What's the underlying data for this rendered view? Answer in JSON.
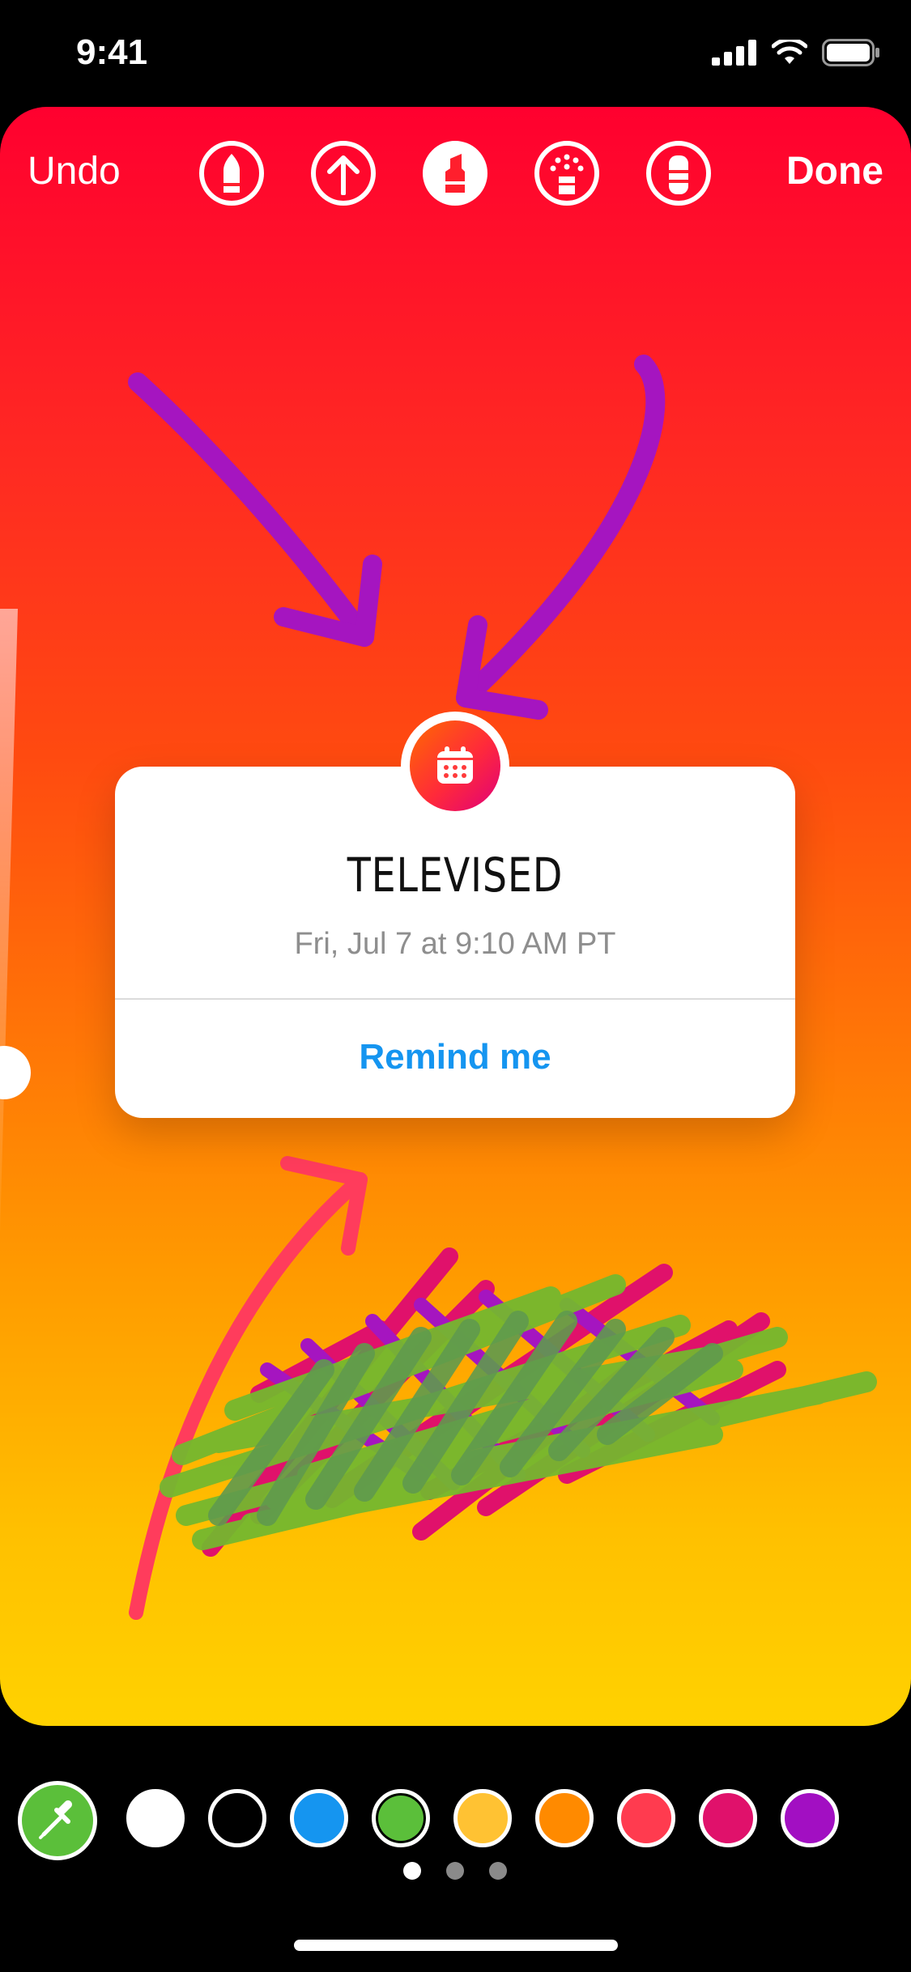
{
  "status_bar": {
    "time": "9:41"
  },
  "toolbar": {
    "undo_label": "Undo",
    "done_label": "Done",
    "tools": [
      "pen-icon",
      "arrow-icon",
      "marker-icon",
      "neon-icon",
      "eraser-icon"
    ],
    "active_tool": "marker-icon"
  },
  "sticker": {
    "title": "TELEVISED",
    "date": "Fri, Jul 7 at 9:10 AM PT",
    "action_label": "Remind me"
  },
  "palette": {
    "colors": [
      "#ffffff",
      "#000000",
      "#1595f0",
      "#5bbf3a",
      "#ffc233",
      "#ff8a00",
      "#ff3b4f",
      "#e0116b",
      "#a20fc2"
    ],
    "selected_color": "#5bbf3a",
    "pages": 3,
    "active_page": 1
  },
  "accent_colors": {
    "canvas_top": "#ff002f",
    "canvas_bottom": "#ffd200",
    "link_blue": "#1595f0"
  }
}
